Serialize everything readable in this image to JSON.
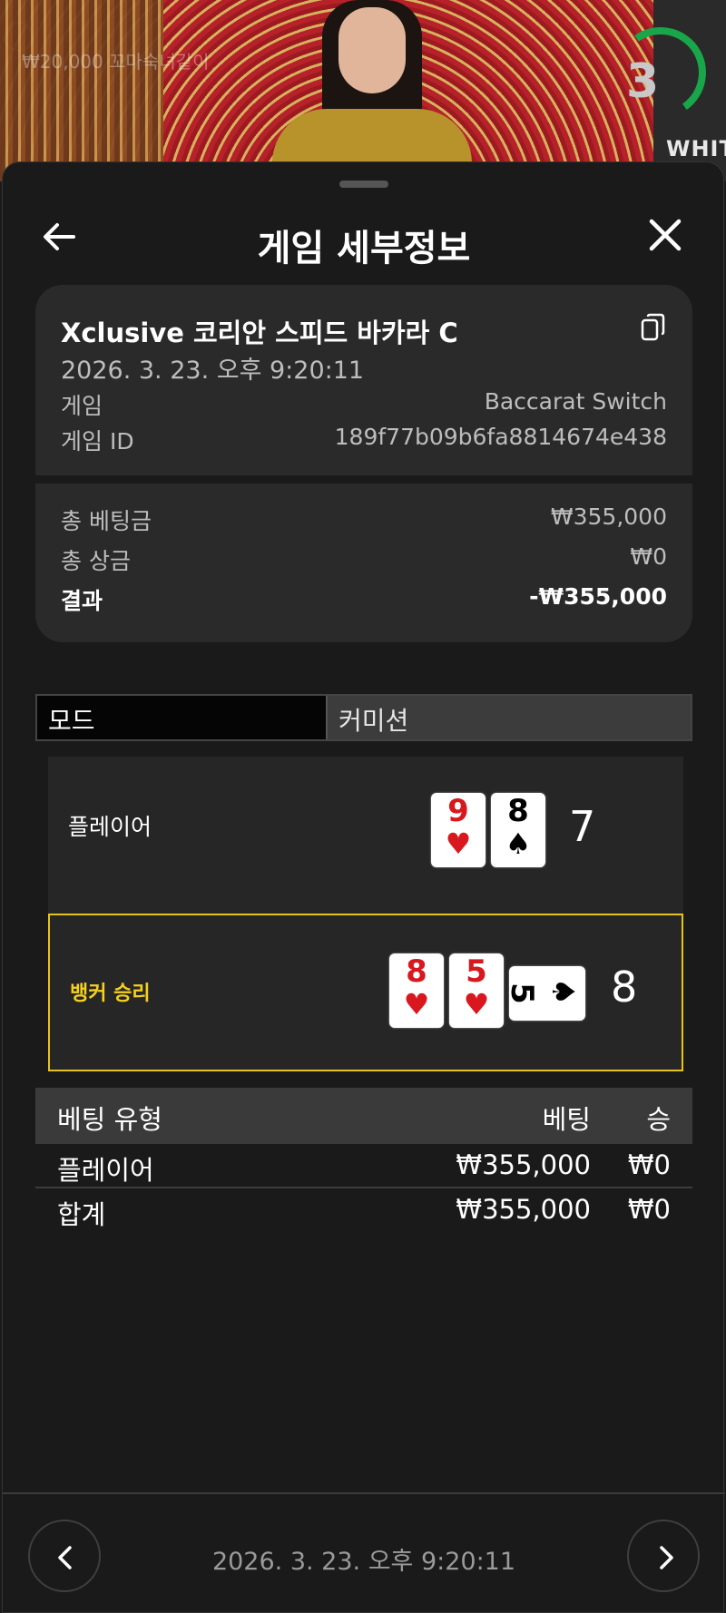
{
  "video": {
    "watermark": "₩20,000  꼬마숙녀같이",
    "timer": "3",
    "brand": "WHIT"
  },
  "header": {
    "title": "게임 세부정보"
  },
  "summary": {
    "table_name": "Xclusive 코리안 스피드 바카라 C",
    "datetime": "2026. 3. 23. 오후 9:20:11",
    "game_label": "게임",
    "game_value": "Baccarat Switch",
    "game_id_label": "게임 ID",
    "game_id_value": "189f77b09b6fa8814674e438"
  },
  "totals": {
    "total_bet_label": "총 베팅금",
    "total_bet_value": "₩355,000",
    "total_win_label": "총 상금",
    "total_win_value": "₩0",
    "result_label": "결과",
    "result_value": "-₩355,000"
  },
  "tabs": {
    "mode": "모드",
    "commission": "커미션"
  },
  "player": {
    "label": "플레이어",
    "score": "7",
    "cards": [
      {
        "rank": "9",
        "suit": "♥"
      },
      {
        "rank": "8",
        "suit": "♠"
      }
    ]
  },
  "banker": {
    "label": "뱅커 승리",
    "score": "8",
    "cards": [
      {
        "rank": "8",
        "suit": "♥"
      },
      {
        "rank": "5",
        "suit": "♥"
      },
      {
        "rank": "5",
        "suit": "♠"
      }
    ]
  },
  "bets": {
    "headers": {
      "type": "베팅 유형",
      "bet": "베팅",
      "win": "승"
    },
    "rows": [
      {
        "type": "플레이어",
        "bet": "₩355,000",
        "win": "₩0"
      }
    ],
    "total": {
      "type": "합계",
      "bet": "₩355,000",
      "win": "₩0"
    }
  },
  "footer": {
    "datetime": "2026. 3. 23. 오후 9:20:11"
  },
  "colors": {
    "winner_highlight": "#e6c41e",
    "red_suit": "#d8181e",
    "sheet_bg": "#1a1a1a",
    "card_bg": "#2a2a2a"
  }
}
